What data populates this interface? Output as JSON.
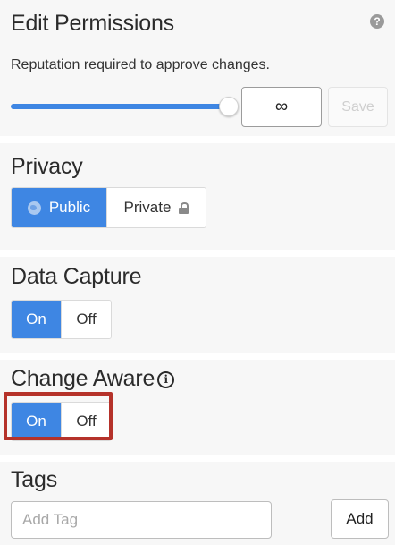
{
  "edit_permissions": {
    "title": "Edit Permissions",
    "help_icon": "question-circle-icon",
    "help_glyph": "?",
    "description": "Reputation required to approve changes.",
    "slider_level": 1.0,
    "value": "∞",
    "save_label": "Save"
  },
  "privacy": {
    "title": "Privacy",
    "public_label": "Public",
    "public_icon": "globe-icon",
    "private_label": "Private",
    "private_icon": "lock-icon",
    "selected": "Public"
  },
  "data_capture": {
    "title": "Data Capture",
    "on_label": "On",
    "off_label": "Off",
    "selected": "On"
  },
  "change_aware": {
    "title": "Change Aware",
    "info_icon": "info-circle-icon",
    "info_glyph": "i",
    "on_label": "On",
    "off_label": "Off",
    "selected": "On"
  },
  "tags": {
    "title": "Tags",
    "placeholder": "Add Tag",
    "add_label": "Add"
  },
  "colors": {
    "accent": "#3e86e3",
    "highlight": "#b5322a",
    "panel_bg": "#f7f7f7"
  }
}
